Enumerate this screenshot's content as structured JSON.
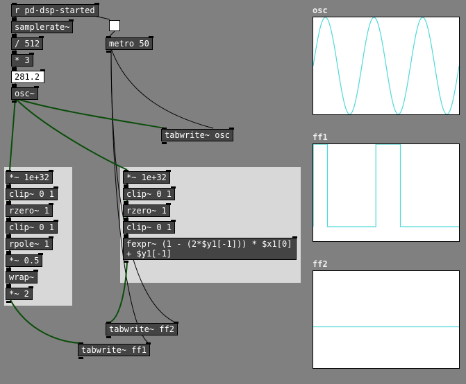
{
  "objects": {
    "receive": "r pd-dsp-started",
    "samplerate": "samplerate~",
    "div512": "/ 512",
    "mul3": "* 3",
    "numbox": "281.2",
    "osc": "osc~",
    "metro": "metro 50",
    "tabwrite_osc": "tabwrite~ osc",
    "tabwrite_ff1": "tabwrite~ ff1",
    "tabwrite_ff2": "tabwrite~ ff2",
    "left": {
      "mul_big": "*~ 1e+32",
      "clip1": "clip~ 0 1",
      "rzero": "rzero~ 1",
      "clip2": "clip~ 0 1",
      "rpole": "rpole~ 1",
      "mul_half": "*~ 0.5",
      "wrap": "wrap~",
      "mul2": "*~ 2"
    },
    "right": {
      "mul_big": "*~ 1e+32",
      "clip1": "clip~ 0 1",
      "rzero": "rzero~ 1",
      "clip2": "clip~ 0 1",
      "fexpr": "fexpr~ (1 - (2*$y1[-1])) * $x1[0]\n+ $y1[-1]"
    }
  },
  "arrays": {
    "osc": "osc",
    "ff1": "ff1",
    "ff2": "ff2"
  },
  "chart_data": [
    {
      "name": "osc",
      "type": "line",
      "title": "osc",
      "xlabel": "",
      "ylabel": "",
      "xlim": [
        0,
        512
      ],
      "ylim": [
        -1,
        1
      ],
      "note": "3 full sine cycles across the buffer",
      "x": [
        0,
        42.7,
        85.3,
        128,
        170.7,
        213.3,
        256,
        298.7,
        341.3,
        384,
        426.7,
        469.3,
        512
      ],
      "values": [
        0,
        1,
        0,
        -1,
        0,
        1,
        0,
        -1,
        0,
        1,
        0,
        -1,
        0
      ]
    },
    {
      "name": "ff1",
      "type": "line",
      "title": "ff1",
      "xlabel": "",
      "ylabel": "",
      "xlim": [
        0,
        512
      ],
      "ylim": [
        -1,
        1
      ],
      "note": "square-like; starts low, 1.5 cycles visible → rest mostly high (constant after ~306)",
      "x": [
        0,
        0.01,
        50,
        50.01,
        220,
        220.01,
        306,
        306.01,
        512
      ],
      "values": [
        -0.7,
        1,
        1,
        -0.7,
        -0.7,
        1,
        1,
        -0.7,
        -0.7
      ]
    },
    {
      "name": "ff2",
      "type": "line",
      "title": "ff2",
      "xlabel": "",
      "ylabel": "",
      "xlim": [
        0,
        512
      ],
      "ylim": [
        -1,
        1
      ],
      "note": "nearly flat line slightly below zero",
      "x": [
        0,
        512
      ],
      "values": [
        -0.15,
        -0.15
      ]
    }
  ]
}
